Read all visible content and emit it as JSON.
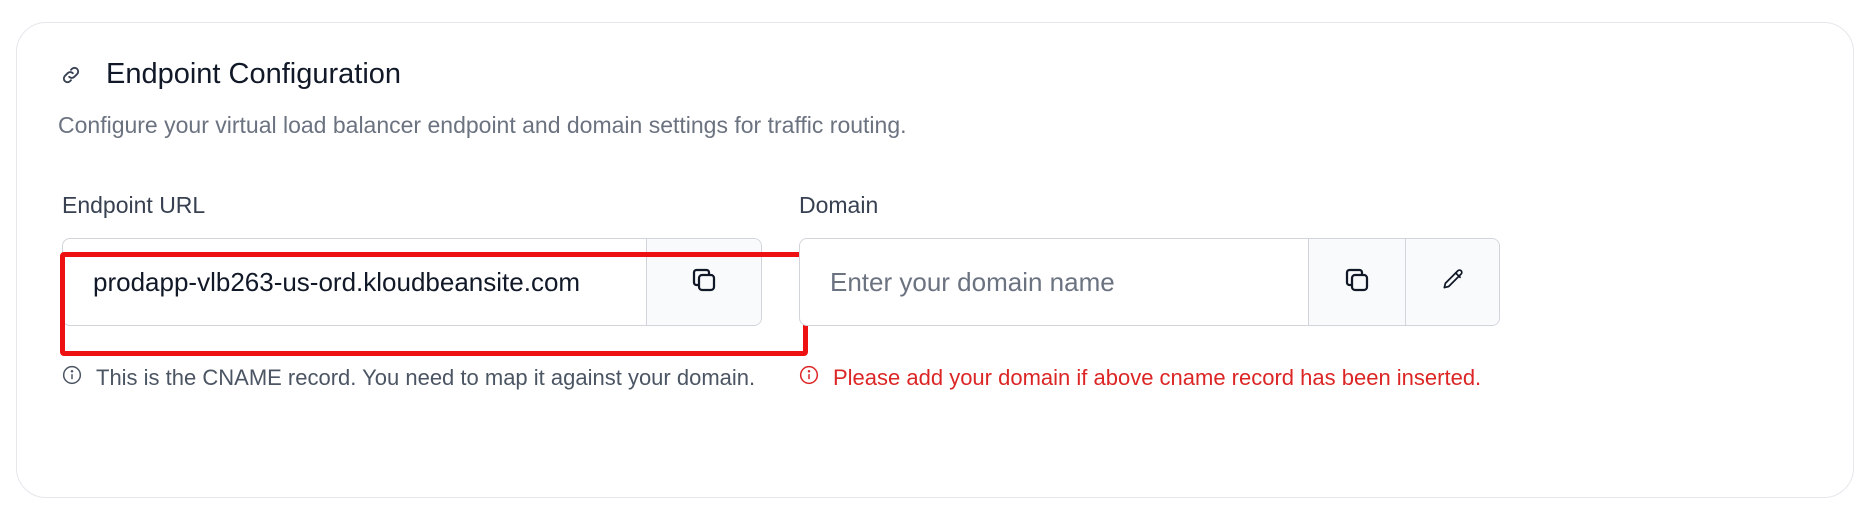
{
  "section": {
    "title": "Endpoint Configuration",
    "icon": "link-icon",
    "subtitle": "Configure your virtual load balancer endpoint and domain settings for traffic routing."
  },
  "endpoint": {
    "label": "Endpoint URL",
    "value": "prodapp-vlb263-us-ord.kloudbeansite.com",
    "copy_icon": "copy-icon",
    "hint": "This is the CNAME record. You need to map it against your domain.",
    "hint_icon": "info-icon"
  },
  "domain": {
    "label": "Domain",
    "placeholder": "Enter your domain name",
    "copy_icon": "copy-icon",
    "edit_icon": "pencil-icon",
    "error": "Please add your domain if above cname record has been inserted.",
    "error_icon": "info-icon",
    "error_color": "#dc2626"
  },
  "highlight_color": "#ee1111"
}
